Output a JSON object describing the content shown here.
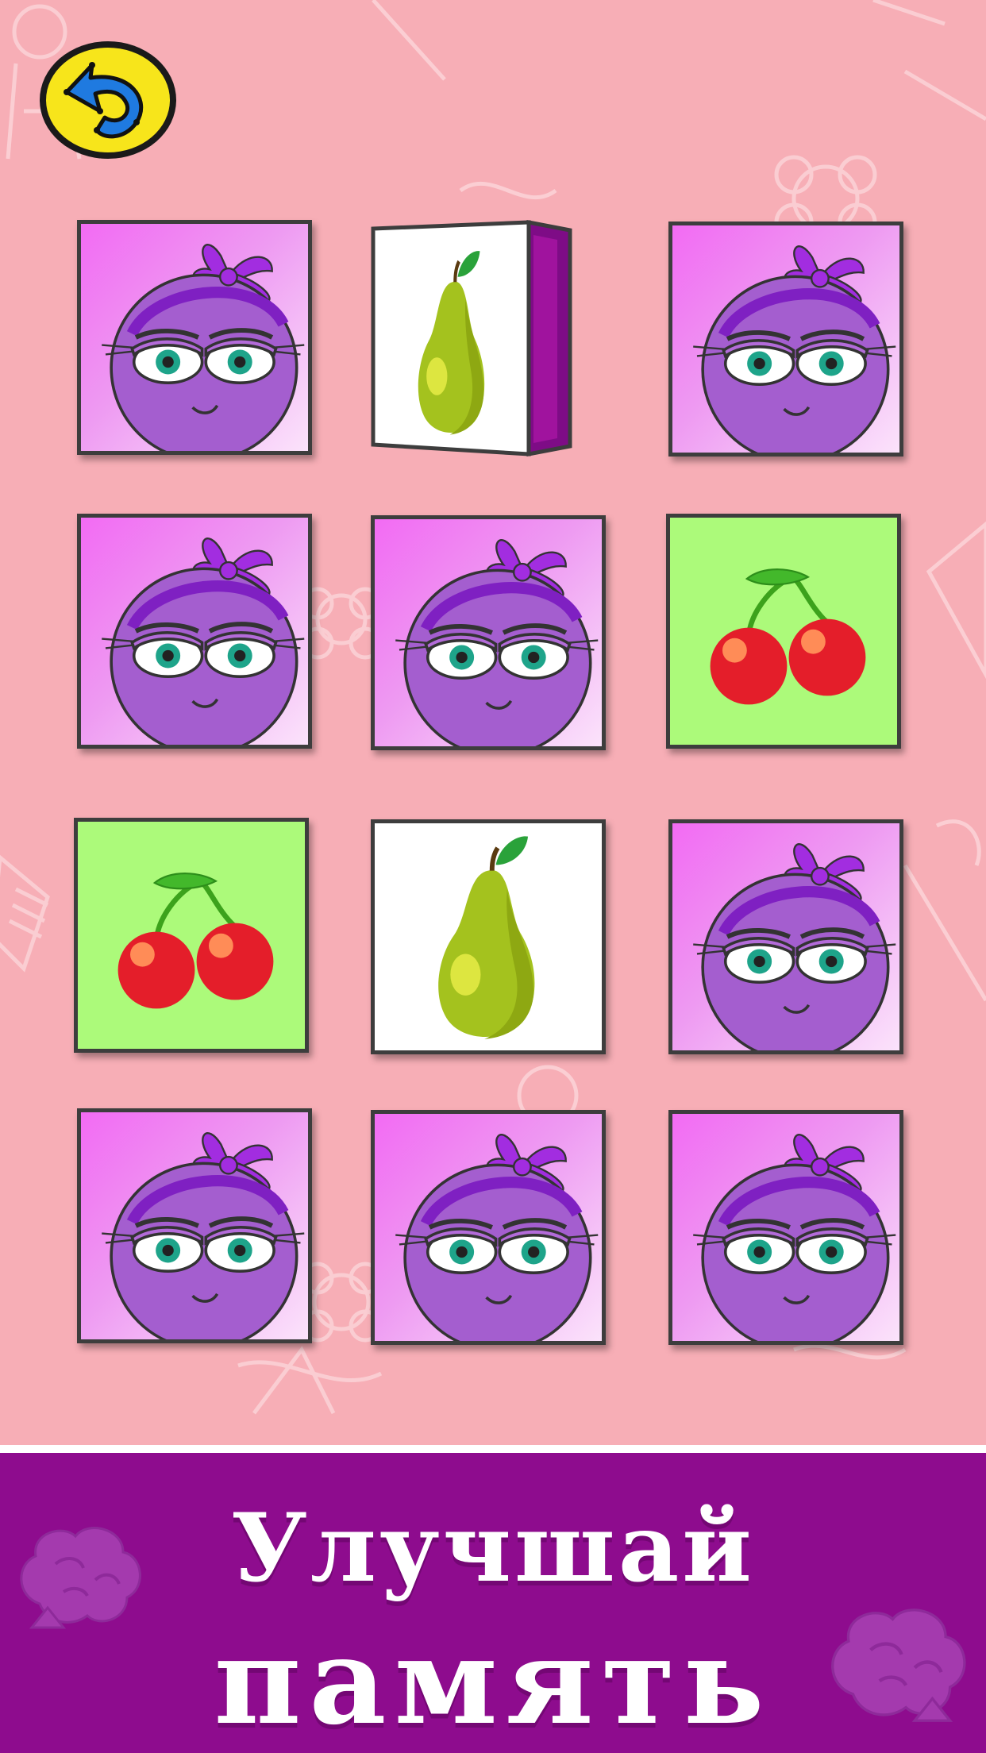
{
  "game": {
    "back_button_icon": "undo-arrow-icon",
    "card_back_icon": "purple-berry-face-icon",
    "card_types": {
      "face_down": "purple-berry-face-icon",
      "cherry": "cherry-icon",
      "pear": "pear-icon"
    },
    "grid": [
      [
        "face_down",
        "pear_flipping",
        "face_down"
      ],
      [
        "face_down",
        "face_down",
        "cherry"
      ],
      [
        "cherry",
        "pear",
        "face_down"
      ],
      [
        "face_down",
        "face_down",
        "face_down"
      ]
    ]
  },
  "banner": {
    "line1": "Улучшай",
    "line2": "память",
    "icon": "brain-icon"
  },
  "colors": {
    "background": "#f7aeb6",
    "banner": "#8e0c8e",
    "card_back": "#f26bf3",
    "cherry_card": "#acfa7a",
    "pear_card": "#ffffff",
    "back_button": "#f7e51b"
  }
}
